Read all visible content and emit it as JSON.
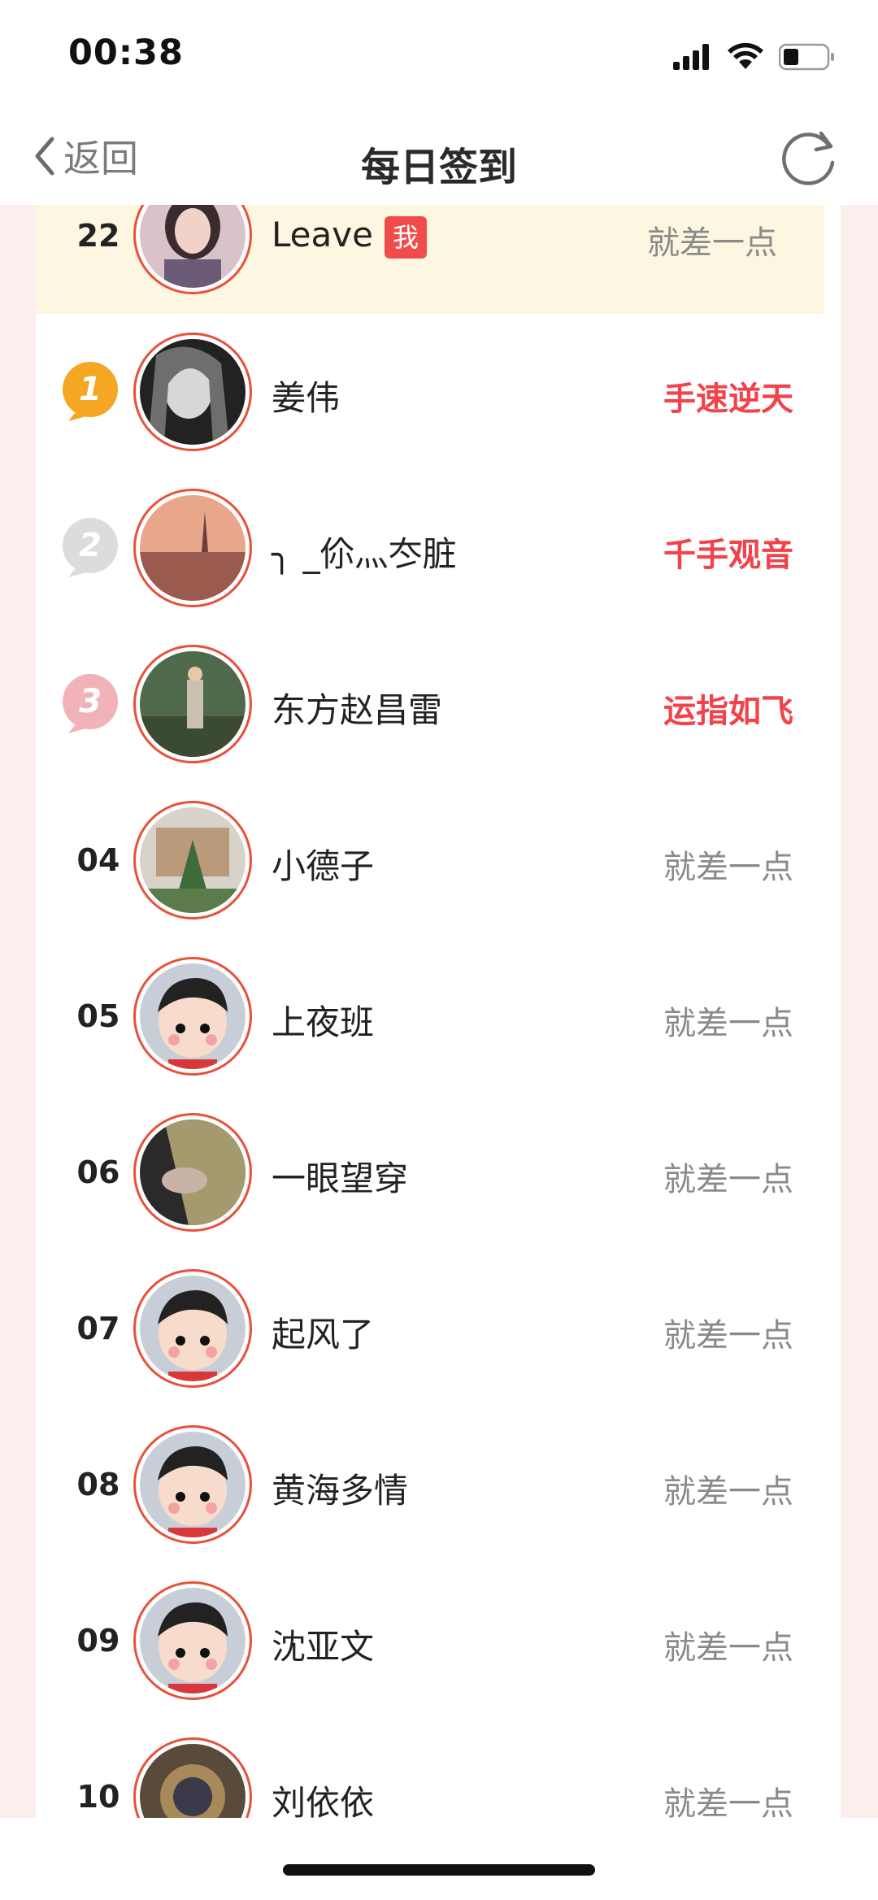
{
  "status_bar": {
    "time": "00:38"
  },
  "nav": {
    "back_label": "返回",
    "title": "每日签到"
  },
  "my_entry": {
    "rank": "22",
    "name": "Leave",
    "badge": "我",
    "status": "就差一点"
  },
  "rankings": [
    {
      "rank": "1",
      "name": "姜伟",
      "status": "手速逆天",
      "medal": "gold"
    },
    {
      "rank": "2",
      "name": "╮ _伱灬冭脏",
      "status": "千手观音",
      "medal": "silver"
    },
    {
      "rank": "3",
      "name": "东方赵昌雷",
      "status": "运指如飞",
      "medal": "bronze"
    },
    {
      "rank": "04",
      "name": "小德子",
      "status": "就差一点"
    },
    {
      "rank": "05",
      "name": "上夜班",
      "status": "就差一点"
    },
    {
      "rank": "06",
      "name": "一眼望穿",
      "status": "就差一点"
    },
    {
      "rank": "07",
      "name": "起风了",
      "status": "就差一点"
    },
    {
      "rank": "08",
      "name": "黄海多情",
      "status": "就差一点"
    },
    {
      "rank": "09",
      "name": "沈亚文",
      "status": "就差一点"
    },
    {
      "rank": "10",
      "name": "刘依依",
      "status": "就差一点"
    }
  ],
  "colors": {
    "accent_red": "#f2424a",
    "ring": "#e8503a",
    "gold": "#f5a623",
    "silver": "#d6d6d6",
    "bronze": "#f2b3b3"
  }
}
